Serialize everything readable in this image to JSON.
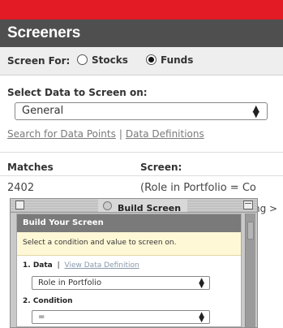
{
  "header": {
    "title": "Screeners"
  },
  "screen_for": {
    "label": "Screen For:",
    "options": [
      {
        "label": "Stocks",
        "selected": false
      },
      {
        "label": "Funds",
        "selected": true
      }
    ]
  },
  "select_data": {
    "title": "Select Data to Screen on:",
    "dropdown_value": "General",
    "link_search": "Search for Data Points",
    "link_separator": "|",
    "link_definitions": "Data Definitions"
  },
  "matches": {
    "header_matches": "Matches",
    "header_screen": "Screen:",
    "count": "2402",
    "screen_text": "(Role in Portfolio = Co",
    "screen_text_2": "ng >"
  },
  "build_window": {
    "title": "Build Screen",
    "panel_title": "Build Your Screen",
    "hint": "Select a condition and value to screen on.",
    "step1_label": "1. Data",
    "step1_sep": "|",
    "step1_link": "View Data Definition",
    "data_dropdown_value": "Role in Portfolio",
    "step2_label": "2. Condition",
    "condition_dropdown_value": "="
  }
}
